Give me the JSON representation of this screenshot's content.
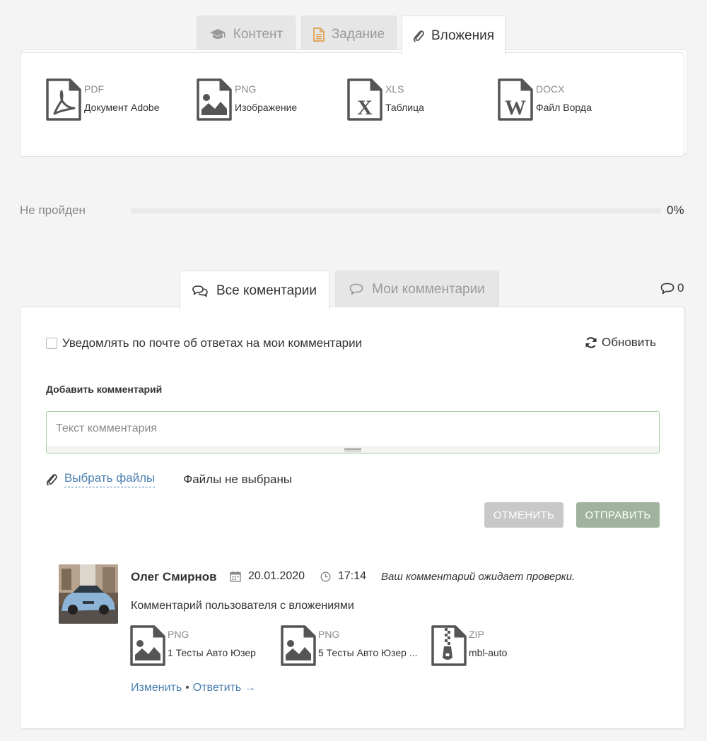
{
  "tabs": [
    {
      "label": "Контент",
      "icon": "graduation-cap-icon"
    },
    {
      "label": "Задание",
      "icon": "document-icon"
    },
    {
      "label": "Вложения",
      "icon": "paperclip-icon"
    }
  ],
  "attachments": [
    {
      "ext": "PDF",
      "name": "Документ Adobe",
      "icon": "pdf-file-icon"
    },
    {
      "ext": "PNG",
      "name": "Изображение",
      "icon": "image-file-icon"
    },
    {
      "ext": "XLS",
      "name": "Таблица",
      "icon": "excel-file-icon"
    },
    {
      "ext": "DOCX",
      "name": "Файл Ворда",
      "icon": "word-file-icon"
    }
  ],
  "progress": {
    "label": "Не пройден",
    "value_text": "0%",
    "fraction": 0
  },
  "comment_tabs": [
    {
      "label": "Все коментарии",
      "icon": "comments-icon"
    },
    {
      "label": "Мои комментарии",
      "icon": "comment-icon"
    }
  ],
  "comment_count": "0",
  "notify_label": "Уведомлять по почте об ответах на мои комментарии",
  "refresh_label": "Обновить",
  "add_comment_title": "Добавить комментарий",
  "comment_placeholder": "Текст комментария",
  "choose_files_label": "Выбрать файлы",
  "no_files_label": "Файлы не выбраны",
  "cancel_label": "ОТМЕНИТЬ",
  "send_label": "ОТПРАВИТЬ",
  "comment": {
    "author": "Олег Смирнов",
    "date": "20.01.2020",
    "time": "17:14",
    "status": "Ваш комментарий ожидает проверки.",
    "text": "Комментарий пользователя с вложениями",
    "attachments": [
      {
        "ext": "PNG",
        "name": "1 Тесты Авто Юзер",
        "icon": "image-file-icon"
      },
      {
        "ext": "PNG",
        "name": "5 Тесты Авто Юзер ...",
        "icon": "image-file-icon"
      },
      {
        "ext": "ZIP",
        "name": "mbl-auto",
        "icon": "zip-file-icon"
      }
    ],
    "edit_label": "Изменить",
    "separator": "•",
    "reply_label": "Ответить →"
  },
  "colors": {
    "link": "#4b7fb0",
    "send_button": "#9fb39f",
    "cancel_button": "#c8c8c8",
    "input_border": "#9fcf9f"
  }
}
